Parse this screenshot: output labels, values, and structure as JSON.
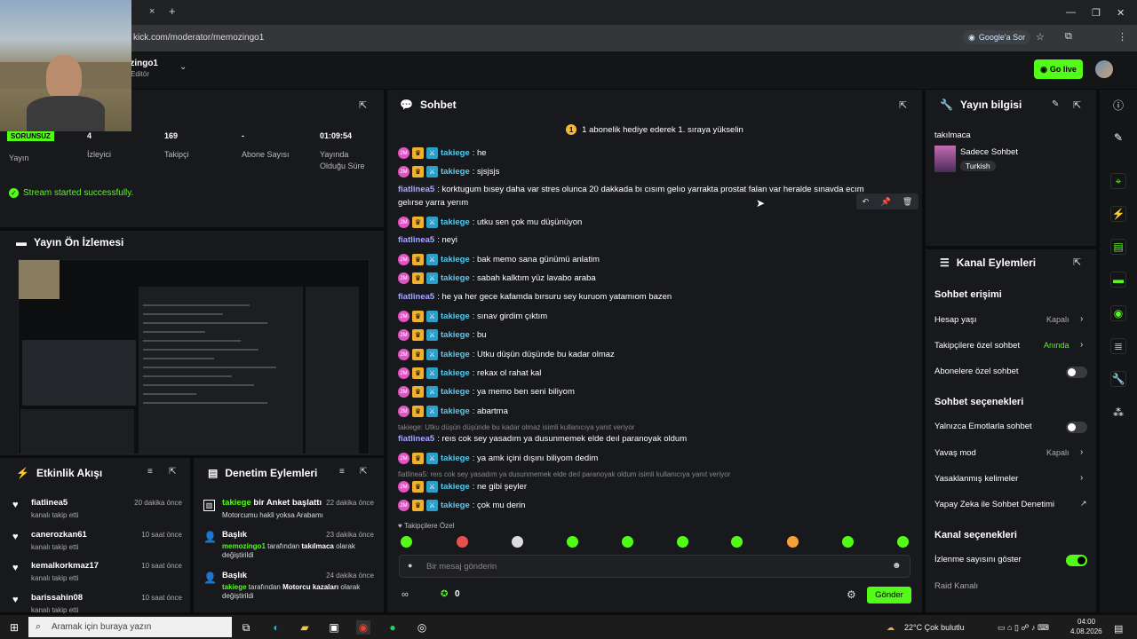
{
  "browser": {
    "tab_close": "×",
    "new_tab": "+",
    "url": "kick.com/moderator/memozingo1",
    "google_ask": "Google'a Sor",
    "win_minimize": "—",
    "win_restore": "❐",
    "win_close": "✕"
  },
  "header": {
    "channel_name": "memozingo1",
    "channel_role": "Editör",
    "go_live": "Go live"
  },
  "stats": {
    "badge": "SORUNSUZ",
    "items": [
      {
        "value": "",
        "label": "Yayın"
      },
      {
        "value": "4",
        "label": "İzleyici"
      },
      {
        "value": "169",
        "label": "Takipçi"
      },
      {
        "value": "-",
        "label": "Abone Sayısı"
      },
      {
        "value": "01:09:54",
        "label": "Yayında Olduğu Süre"
      }
    ],
    "stream_status": "Stream started successfully."
  },
  "preview": {
    "title": "Yayın Ön İzlemesi"
  },
  "activity": {
    "title": "Etkinlik Akışı",
    "items": [
      {
        "name": "fiatlinea5",
        "sub": "kanalı takip etti",
        "time": "20 dakika önce"
      },
      {
        "name": "canerozkan61",
        "sub": "kanalı takip etti",
        "time": "10 saat önce"
      },
      {
        "name": "kemalkorkmaz17",
        "sub": "kanalı takip etti",
        "time": "10 saat önce"
      },
      {
        "name": "barissahin08",
        "sub": "kanalı takip etti",
        "time": "10 saat önce"
      }
    ]
  },
  "moderation": {
    "title": "Denetim Eylemleri",
    "items": [
      {
        "line1a": "takiege",
        "line1b": " bir Anket başlattı",
        "time": "22 dakika önce",
        "line2a": "Motorcumu hakli yoksa Arabamı",
        "line2b": "",
        "line2c": ""
      },
      {
        "line1a": "Başlık",
        "line1b": "",
        "time": "23 dakika önce",
        "line2a": "memozingo1",
        "line2b": " tarafından ",
        "line2c": "takılmaca",
        "line3": " olarak değiştirildi"
      },
      {
        "line1a": "Başlık",
        "line1b": "",
        "time": "24 dakika önce",
        "line2a": "takiege",
        "line2b": " tarafından ",
        "line2c": "Motorcu kazaları",
        "line3": " olarak değiştirildi"
      }
    ]
  },
  "chat": {
    "title": "Sohbet",
    "pinned_coin": "1",
    "pinned": "1 abonelik hediye ederek 1. sıraya yükselin",
    "messages": [
      {
        "user": "takiege",
        "text": ": he"
      },
      {
        "user": "takiege",
        "text": ": sjsjsjs"
      },
      {
        "user": "fiatlinea5",
        "text": ": korktugum bısey daha var stres olunca 20 dakkada bı cısım gelıo yarrakta prostat falan var heralde sınavda ecım",
        "text2": "gelırse yarra yerım"
      },
      {
        "user": "takiege",
        "text": ": utku sen çok mu düşünüyon"
      },
      {
        "user": "fiatlinea5",
        "text": ": neyi"
      },
      {
        "user": "takiege",
        "text": ": bak memo sana günümü anlatim"
      },
      {
        "user": "takiege",
        "text": ": sabah kalktım yüz lavabo araba"
      },
      {
        "user": "fiatlinea5",
        "text": ": he ya her gece kafamda bırsuru sey kuruom yatamıom bazen"
      },
      {
        "user": "takiege",
        "text": ": sınav girdim çıktım"
      },
      {
        "user": "takiege",
        "text": ": bu"
      },
      {
        "user": "takiege",
        "text": ": Utku düşün düşünde bu kadar olmaz"
      },
      {
        "user": "takiege",
        "text": ": rekax ol rahat kal"
      },
      {
        "user": "takiege",
        "text": ": ya memo ben seni biliyom"
      },
      {
        "user": "takiege",
        "text": ": abartma"
      },
      {
        "reply": "takiege: Utku düşün düşünde bu kadar olmaz isimli kullanıcıya yanıt veriyor"
      },
      {
        "user": "fiatlinea5",
        "text": ": reıs cok sey yasadım ya dusunmemek elde deıl paranoyak oldum"
      },
      {
        "user": "takiege",
        "text": ": ya amk içini dışını biliyom dedim"
      },
      {
        "reply": "fiatlinea5: reıs cok sey yasadım ya dusunmemek elde deıl paranoyak oldum isimli kullanıcıya yanıt veriyor"
      },
      {
        "user": "takiege",
        "text": ": ne gibi şeyler"
      },
      {
        "user": "takiege",
        "text": ": çok mu derin"
      }
    ],
    "followers_only": "Takipçilere Özel",
    "input_placeholder": "Bir mesaj gönderin",
    "points": "0",
    "send": "Gönder"
  },
  "stream_info": {
    "title": "Yayın bilgisi",
    "stream_title": "takılmaca",
    "category": "Sadece Sohbet",
    "language": "Turkish"
  },
  "channel_actions": {
    "title": "Kanal Eylemleri",
    "chat_access": "Sohbet erişimi",
    "account_age": "Hesap yaşı",
    "account_age_val": "Kapalı",
    "followers_chat": "Takipçilere özel sohbet",
    "followers_chat_val": "Anında",
    "subs_chat": "Abonelere özel sohbet",
    "chat_options": "Sohbet seçenekleri",
    "emote_only": "Yalnızca Emotlarla sohbet",
    "slow_mode": "Yavaş mod",
    "slow_mode_val": "Kapalı",
    "banned_words": "Yasaklanmış kelimeler",
    "ai_mod": "Yapay Zeka ile Sohbet Denetimi",
    "channel_options": "Kanal seçenekleri",
    "show_viewers": "İzlenme sayısını göster",
    "raid": "Raid Kanalı"
  },
  "taskbar": {
    "search": "Aramak için buraya yazın",
    "temp": "22°C  Çok bulutlu",
    "time": "04:00",
    "date": "4.08.2026"
  },
  "colors": {
    "accent": "#53fc18",
    "username": "#53ccf2",
    "panel": "#18191c"
  }
}
